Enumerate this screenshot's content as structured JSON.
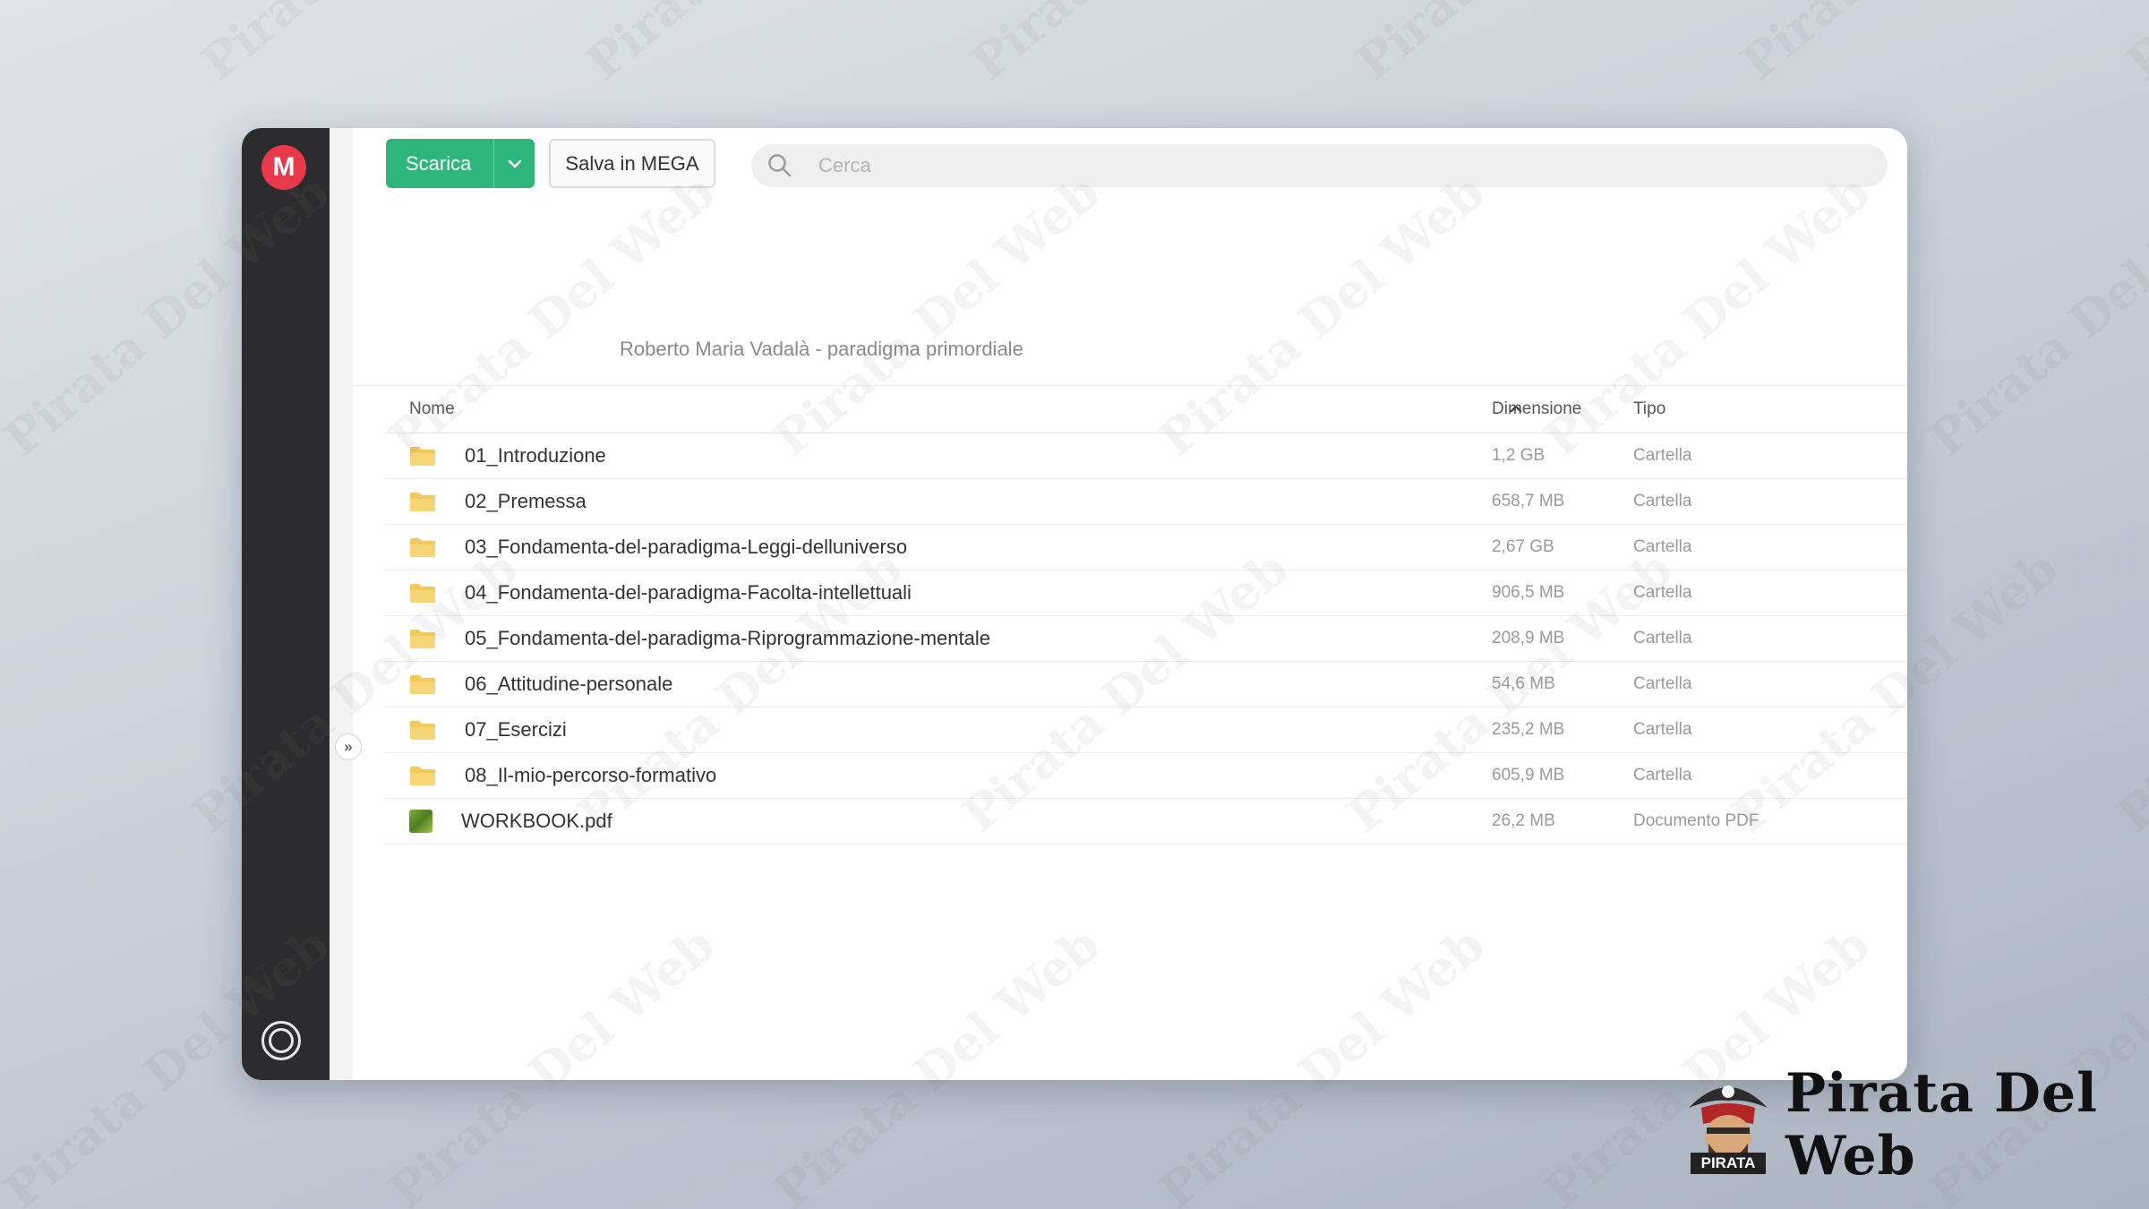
{
  "app": {
    "logo_letter": "M",
    "accent": "#2fb67c",
    "logo_color": "#e8394a"
  },
  "toolbar": {
    "download_label": "Scarica",
    "save_label": "Salva in MEGA"
  },
  "search": {
    "placeholder": "Cerca",
    "value": ""
  },
  "breadcrumb": "Roberto Maria Vadalà - paradigma primordiale",
  "table": {
    "headers": {
      "name": "Nome",
      "size": "Dimensione",
      "type": "Tipo"
    },
    "sort": "ascending",
    "rows": [
      {
        "name": "01_Introduzione",
        "size": "1,2 GB",
        "type": "Cartella",
        "icon": "folder-icon"
      },
      {
        "name": "02_Premessa",
        "size": "658,7 MB",
        "type": "Cartella",
        "icon": "folder-icon"
      },
      {
        "name": "03_Fondamenta-del-paradigma-Leggi-delluniverso",
        "size": "2,67 GB",
        "type": "Cartella",
        "icon": "folder-icon"
      },
      {
        "name": "04_Fondamenta-del-paradigma-Facolta-intellettuali",
        "size": "906,5 MB",
        "type": "Cartella",
        "icon": "folder-icon"
      },
      {
        "name": "05_Fondamenta-del-paradigma-Riprogrammazione-mentale",
        "size": "208,9 MB",
        "type": "Cartella",
        "icon": "folder-icon"
      },
      {
        "name": "06_Attitudine-personale",
        "size": "54,6 MB",
        "type": "Cartella",
        "icon": "folder-icon"
      },
      {
        "name": "07_Esercizi",
        "size": "235,2 MB",
        "type": "Cartella",
        "icon": "folder-icon"
      },
      {
        "name": "08_Il-mio-percorso-formativo",
        "size": "605,9 MB",
        "type": "Cartella",
        "icon": "folder-icon"
      },
      {
        "name": "WORKBOOK.pdf",
        "size": "26,2 MB",
        "type": "Documento PDF",
        "icon": "pdf-icon"
      }
    ]
  },
  "watermark": {
    "text": "Pirata Del Web",
    "badge_label": "PIRATA"
  }
}
